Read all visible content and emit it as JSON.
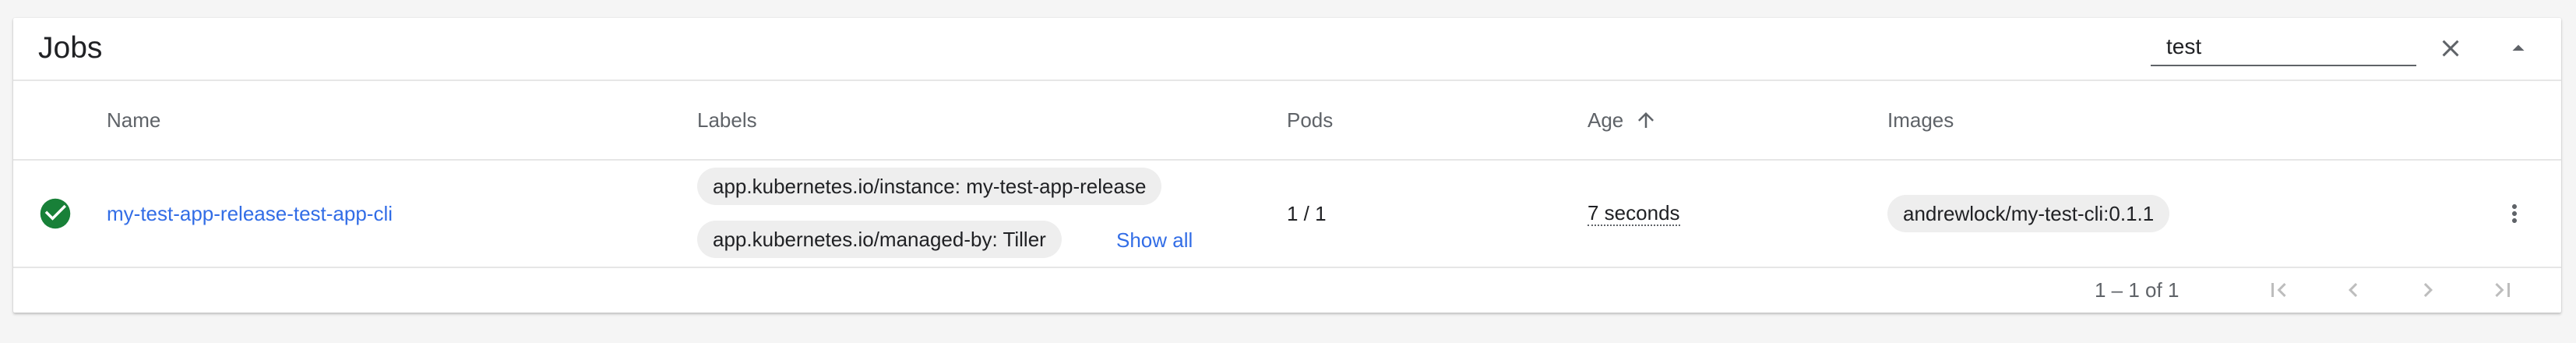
{
  "card": {
    "title": "Jobs",
    "search": {
      "value": "test",
      "placeholder": ""
    }
  },
  "columns": {
    "name": "Name",
    "labels": "Labels",
    "pods": "Pods",
    "age": "Age",
    "images": "Images"
  },
  "rows": [
    {
      "status": "success",
      "name": "my-test-app-release-test-app-cli",
      "labels": [
        "app.kubernetes.io/instance: my-test-app-release",
        "app.kubernetes.io/managed-by: Tiller"
      ],
      "show_all": "Show all",
      "pods": "1 / 1",
      "age": "7 seconds",
      "image": "andrewlock/my-test-cli:0.1.1"
    }
  ],
  "pagination": {
    "range": "1 – 1 of 1"
  },
  "icons": {
    "clear": "close-icon",
    "collapse": "arrow-drop-up-icon",
    "sort": "arrow-upward-icon",
    "status": "check-circle-icon",
    "more": "more-vert-icon",
    "first": "first-page-icon",
    "prev": "chevron-left-icon",
    "next": "chevron-right-icon",
    "last": "last-page-icon"
  },
  "colors": {
    "success": "#188038",
    "link": "#326de6",
    "chip": "#eeeeee",
    "icon": "#5f6368"
  }
}
